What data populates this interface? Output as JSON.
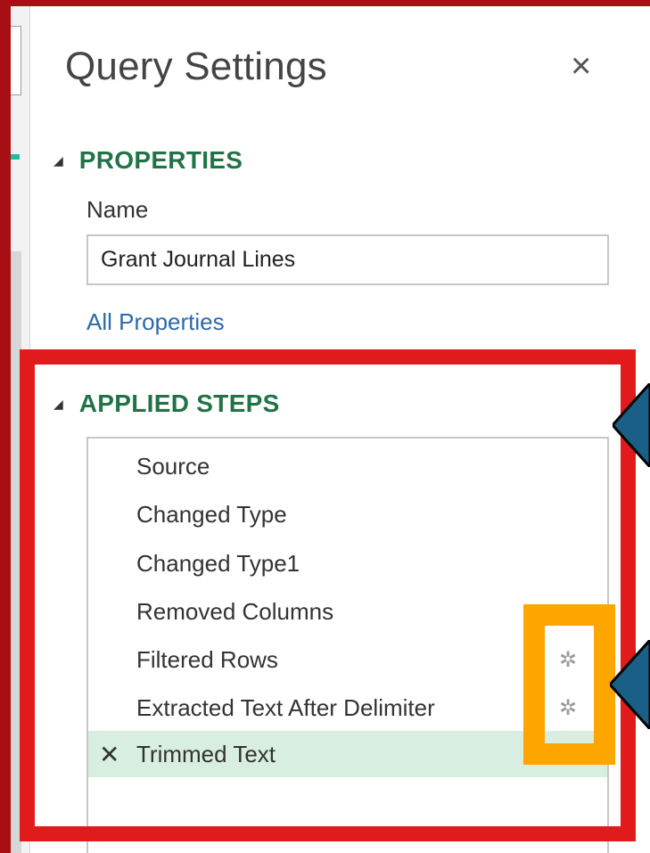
{
  "panel": {
    "title": "Query Settings",
    "close_glyph": "×"
  },
  "properties": {
    "heading": "PROPERTIES",
    "name_label": "Name",
    "name_value": "Grant Journal Lines",
    "all_properties_link": "All Properties"
  },
  "applied_steps": {
    "heading": "APPLIED STEPS",
    "steps": [
      {
        "label": "Source",
        "has_settings": false,
        "selected": false
      },
      {
        "label": "Changed Type",
        "has_settings": false,
        "selected": false
      },
      {
        "label": "Changed Type1",
        "has_settings": false,
        "selected": false
      },
      {
        "label": "Removed Columns",
        "has_settings": false,
        "selected": false
      },
      {
        "label": "Filtered Rows",
        "has_settings": true,
        "selected": false
      },
      {
        "label": "Extracted Text After Delimiter",
        "has_settings": true,
        "selected": false
      },
      {
        "label": "Trimmed Text",
        "has_settings": false,
        "selected": true
      }
    ],
    "delete_glyph": "✕",
    "settings_glyph": "✲"
  },
  "colors": {
    "frame": "#a80f14",
    "heading_green": "#217346",
    "link_blue": "#2b6aa8",
    "selected_row": "#d8eee0",
    "red_highlight": "#e11b1b",
    "orange_highlight": "#ffa500",
    "arrow_fill": "#1a5f86"
  },
  "icons": [
    "close-icon",
    "collapse-triangle-icon",
    "delete-step-icon",
    "gear-icon",
    "callout-arrow-icon"
  ]
}
